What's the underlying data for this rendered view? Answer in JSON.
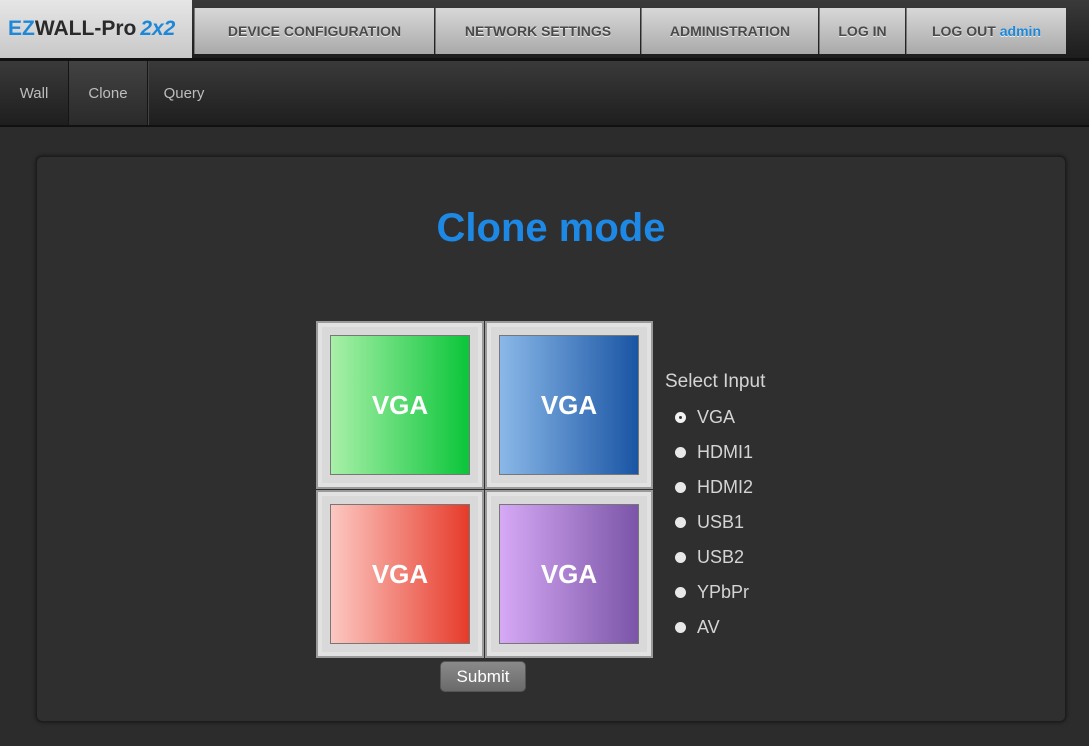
{
  "brand": {
    "prefix": "EZ",
    "name": "WALL-Pro",
    "model": "2x2"
  },
  "nav": {
    "items": [
      {
        "label": "DEVICE CONFIGURATION"
      },
      {
        "label": "NETWORK SETTINGS"
      },
      {
        "label": "ADMINISTRATION"
      },
      {
        "label": "LOG IN"
      },
      {
        "label": "LOG OUT",
        "user": "admin"
      }
    ]
  },
  "subnav": {
    "items": [
      {
        "label": "Wall"
      },
      {
        "label": "Clone"
      },
      {
        "label": "Query"
      }
    ],
    "active": "Clone"
  },
  "main": {
    "title": "Clone mode",
    "tiles": [
      {
        "label": "VGA",
        "color": "green"
      },
      {
        "label": "VGA",
        "color": "blue"
      },
      {
        "label": "VGA",
        "color": "red"
      },
      {
        "label": "VGA",
        "color": "purple"
      }
    ],
    "select_input": {
      "title": "Select Input",
      "options": [
        "VGA",
        "HDMI1",
        "HDMI2",
        "USB1",
        "USB2",
        "YPbPr",
        "AV"
      ],
      "selected": "VGA"
    },
    "submit_label": "Submit"
  },
  "colors": {
    "accent": "#1e88e5",
    "background": "#2c2c2c"
  }
}
